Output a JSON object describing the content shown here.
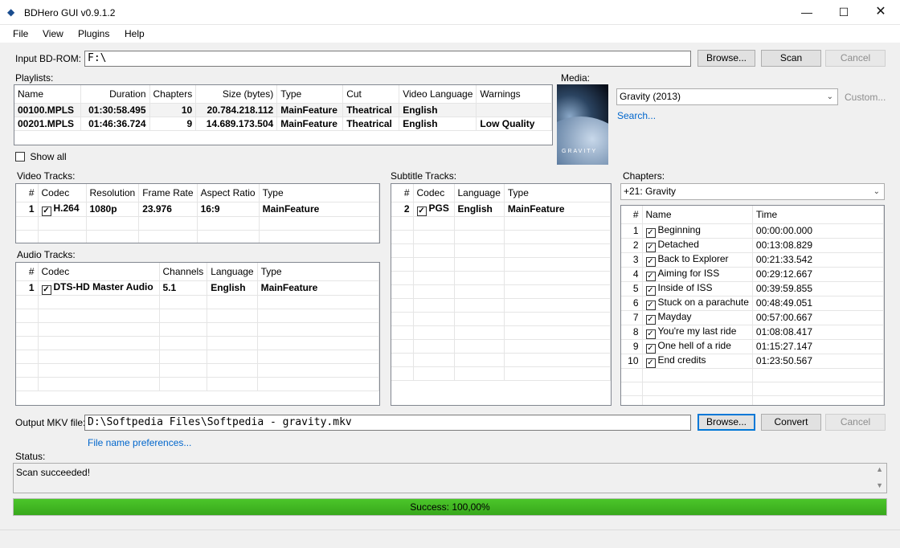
{
  "window": {
    "title": "BDHero GUI v0.9.1.2"
  },
  "menu": [
    "File",
    "View",
    "Plugins",
    "Help"
  ],
  "input": {
    "label": "Input BD-ROM:",
    "value": "F:\\",
    "browse": "Browse...",
    "scan": "Scan",
    "cancel": "Cancel"
  },
  "playlists": {
    "label": "Playlists:",
    "columns": [
      "Name",
      "Duration",
      "Chapters",
      "Size (bytes)",
      "Type",
      "Cut",
      "Video Language",
      "Warnings"
    ],
    "rows": [
      [
        "00100.MPLS",
        "01:30:58.495",
        "10",
        "20.784.218.112",
        "MainFeature",
        "Theatrical",
        "English",
        ""
      ],
      [
        "00201.MPLS",
        "01:46:36.724",
        "9",
        "14.689.173.504",
        "MainFeature",
        "Theatrical",
        "English",
        "Low Quality"
      ]
    ],
    "show_all": "Show all"
  },
  "media": {
    "label": "Media:",
    "selected": "Gravity (2013)",
    "custom": "Custom...",
    "search": "Search...",
    "poster_text": "GRAVITY"
  },
  "video": {
    "label": "Video Tracks:",
    "columns": [
      "#",
      "Codec",
      "Resolution",
      "Frame Rate",
      "Aspect Ratio",
      "Type"
    ],
    "rows": [
      [
        "1",
        "H.264",
        "1080p",
        "23.976",
        "16:9",
        "MainFeature"
      ]
    ]
  },
  "audio": {
    "label": "Audio Tracks:",
    "columns": [
      "#",
      "Codec",
      "Channels",
      "Language",
      "Type"
    ],
    "rows": [
      [
        "1",
        "DTS-HD Master Audio",
        "5.1",
        "English",
        "MainFeature"
      ]
    ]
  },
  "subtitle": {
    "label": "Subtitle Tracks:",
    "columns": [
      "#",
      "Codec",
      "Language",
      "Type"
    ],
    "rows": [
      [
        "2",
        "PGS",
        "English",
        "MainFeature"
      ]
    ]
  },
  "chapters": {
    "label": "Chapters:",
    "selected": "+21: Gravity",
    "columns": [
      "#",
      "Name",
      "Time"
    ],
    "rows": [
      [
        "1",
        "Beginning",
        "00:00:00.000"
      ],
      [
        "2",
        "Detached",
        "00:13:08.829"
      ],
      [
        "3",
        "Back to Explorer",
        "00:21:33.542"
      ],
      [
        "4",
        "Aiming for ISS",
        "00:29:12.667"
      ],
      [
        "5",
        "Inside of ISS",
        "00:39:59.855"
      ],
      [
        "6",
        "Stuck on a parachute",
        "00:48:49.051"
      ],
      [
        "7",
        "Mayday",
        "00:57:00.667"
      ],
      [
        "8",
        "You're my last ride",
        "01:08:08.417"
      ],
      [
        "9",
        "One hell of a ride",
        "01:15:27.147"
      ],
      [
        "10",
        "End credits",
        "01:23:50.567"
      ]
    ]
  },
  "output": {
    "label": "Output MKV file:",
    "value": "D:\\Softpedia Files\\Softpedia - gravity.mkv",
    "browse": "Browse...",
    "convert": "Convert",
    "cancel": "Cancel",
    "prefs": "File name preferences..."
  },
  "status": {
    "label": "Status:",
    "text": "Scan succeeded!"
  },
  "progress": {
    "text": "Success: 100,00%",
    "value": 1.0,
    "color": "#4cc62a"
  }
}
